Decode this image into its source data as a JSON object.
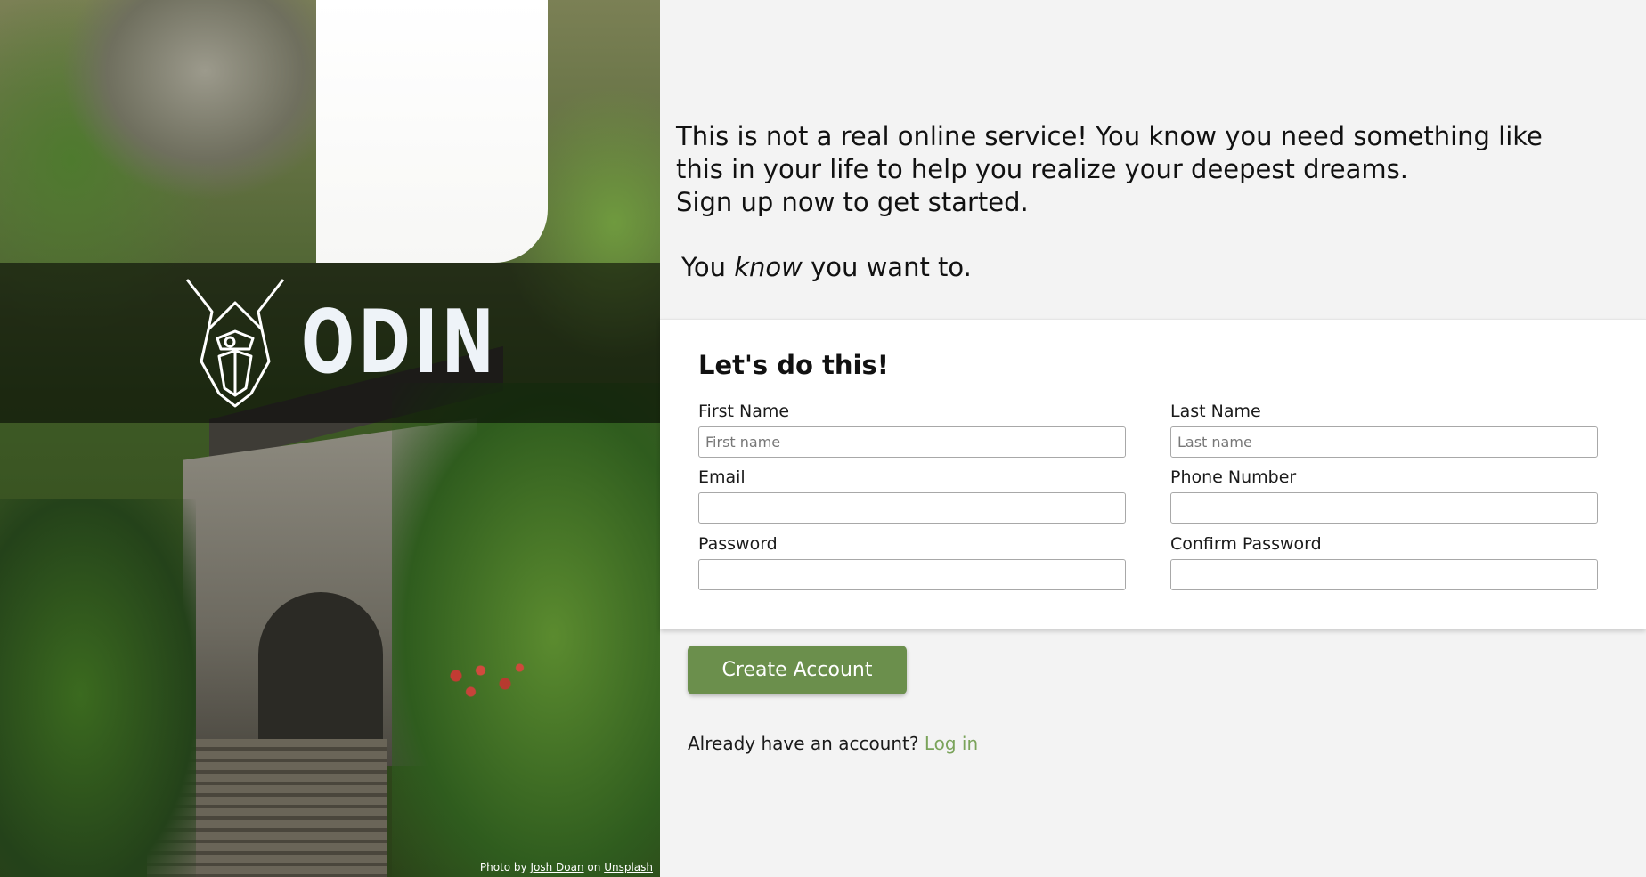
{
  "hero": {
    "logo_text": "ODIN",
    "credit": {
      "prefix": "Photo by",
      "author": "Josh Doan",
      "middle": "on",
      "site": "Unsplash"
    }
  },
  "intro": {
    "line1": "This is not a real online service! You know you need something like",
    "line2": "this in your life to help you realize your deepest dreams.",
    "line3": "Sign up now to get started.",
    "tagline_before": "You",
    "tagline_emphasis": "know",
    "tagline_after": "you want to."
  },
  "form": {
    "heading": "Let's do this!",
    "first_name": {
      "label": "First Name",
      "placeholder": "First name",
      "value": ""
    },
    "last_name": {
      "label": "Last Name",
      "placeholder": "Last name",
      "value": ""
    },
    "email": {
      "label": "Email",
      "placeholder": "",
      "value": ""
    },
    "phone": {
      "label": "Phone Number",
      "placeholder": "",
      "value": ""
    },
    "password": {
      "label": "Password",
      "placeholder": "",
      "value": ""
    },
    "confirm_password": {
      "label": "Confirm Password",
      "placeholder": "",
      "value": ""
    }
  },
  "actions": {
    "create_label": "Create Account",
    "login_prompt": "Already have an account?",
    "login_link": "Log in"
  },
  "colors": {
    "accent": "#6b8f4c",
    "link": "#7aa35a",
    "background": "#f3f3f3"
  }
}
